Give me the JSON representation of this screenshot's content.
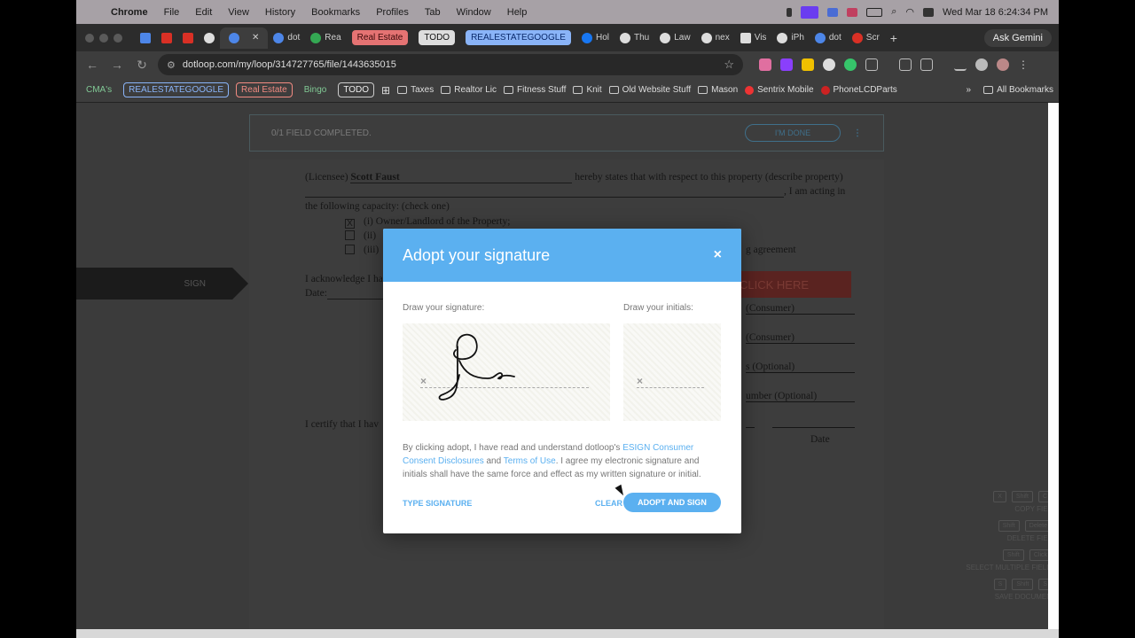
{
  "menubar": {
    "app": "Chrome",
    "items": [
      "File",
      "Edit",
      "View",
      "History",
      "Bookmarks",
      "Profiles",
      "Tab",
      "Window",
      "Help"
    ],
    "datetime": "Wed Mar 18  6:24:34 PM"
  },
  "tabs": {
    "items": [
      "dot",
      "Rea",
      "Hol",
      "Thu",
      "Law",
      "nex",
      "Vis",
      "iPh",
      "dot",
      "Scr"
    ],
    "groups": [
      "Real Estate",
      "TODO",
      "REALESTATEGOOGLE"
    ],
    "ask_gemini": "Ask Gemini"
  },
  "omnibox": {
    "url": "dotloop.com/my/loop/314727765/file/1443635015"
  },
  "bookmarks": {
    "tags": [
      "CMA's",
      "REALESTATEGOOGLE",
      "Real Estate",
      "Bingo",
      "TODO"
    ],
    "folders": [
      "Taxes",
      "Realtor Lic",
      "Fitness Stuff",
      "Knit",
      "Old Website Stuff",
      "Mason",
      "Sentrix Mobile",
      "PhoneLCDParts"
    ],
    "all": "All Bookmarks"
  },
  "page": {
    "status": "0/1 FIELD COMPLETED.",
    "done_button": "I'M DONE",
    "sign_tag": "SIGN",
    "click_here": "CLICK HERE",
    "doc": {
      "l1_pre": "(Licensee)",
      "l1_name": "Scott Faust",
      "l1_post": "hereby states that with respect to this property (describe property)",
      "l2_post": ", I am acting in",
      "l3": "the following capacity: (check one)",
      "opt1_mark": "X",
      "opt1": "(i)  Owner/Landlord of the Property;",
      "opt2": "(ii) ",
      "opt3": "(iii) ",
      "opt3_tail": "g agreement",
      "ack": "I acknowledge I ha",
      "date": "Date:",
      "consumer1": "(Consumer)",
      "consumer2": "(Consumer)",
      "optional1": "s (Optional)",
      "optional2": "umber (Optional)",
      "certify": "I certify that I hav",
      "date2": "Date"
    },
    "shortcuts": {
      "k1": [
        "X",
        "Shift",
        "C"
      ],
      "l1": "COPY FIEL",
      "k2": [
        "Shift",
        "Delete"
      ],
      "l2": "DELETE FIEL",
      "k3": [
        "Shift",
        "Click"
      ],
      "l3": "SELECT MULTIPLE FIELD",
      "k4": [
        "S",
        "Shift",
        "S"
      ],
      "l4": "SAVE DOCUMEN"
    }
  },
  "modal": {
    "title": "Adopt your signature",
    "close": "×",
    "draw_signature": "Draw your signature:",
    "draw_initials": "Draw your initials:",
    "x_mark": "×",
    "disclaimer_1": "By clicking adopt, I have read and understand dotloop's ",
    "esign_link": "ESIGN Consumer Consent Disclosures",
    "and": " and ",
    "terms_link": "Terms of Use",
    "disclaimer_2": ". I agree my electronic signature and initials shall have the same force and effect as my written signature or initial.",
    "type_signature": "TYPE SIGNATURE",
    "clear": "CLEAR",
    "adopt": "ADOPT AND SIGN"
  }
}
